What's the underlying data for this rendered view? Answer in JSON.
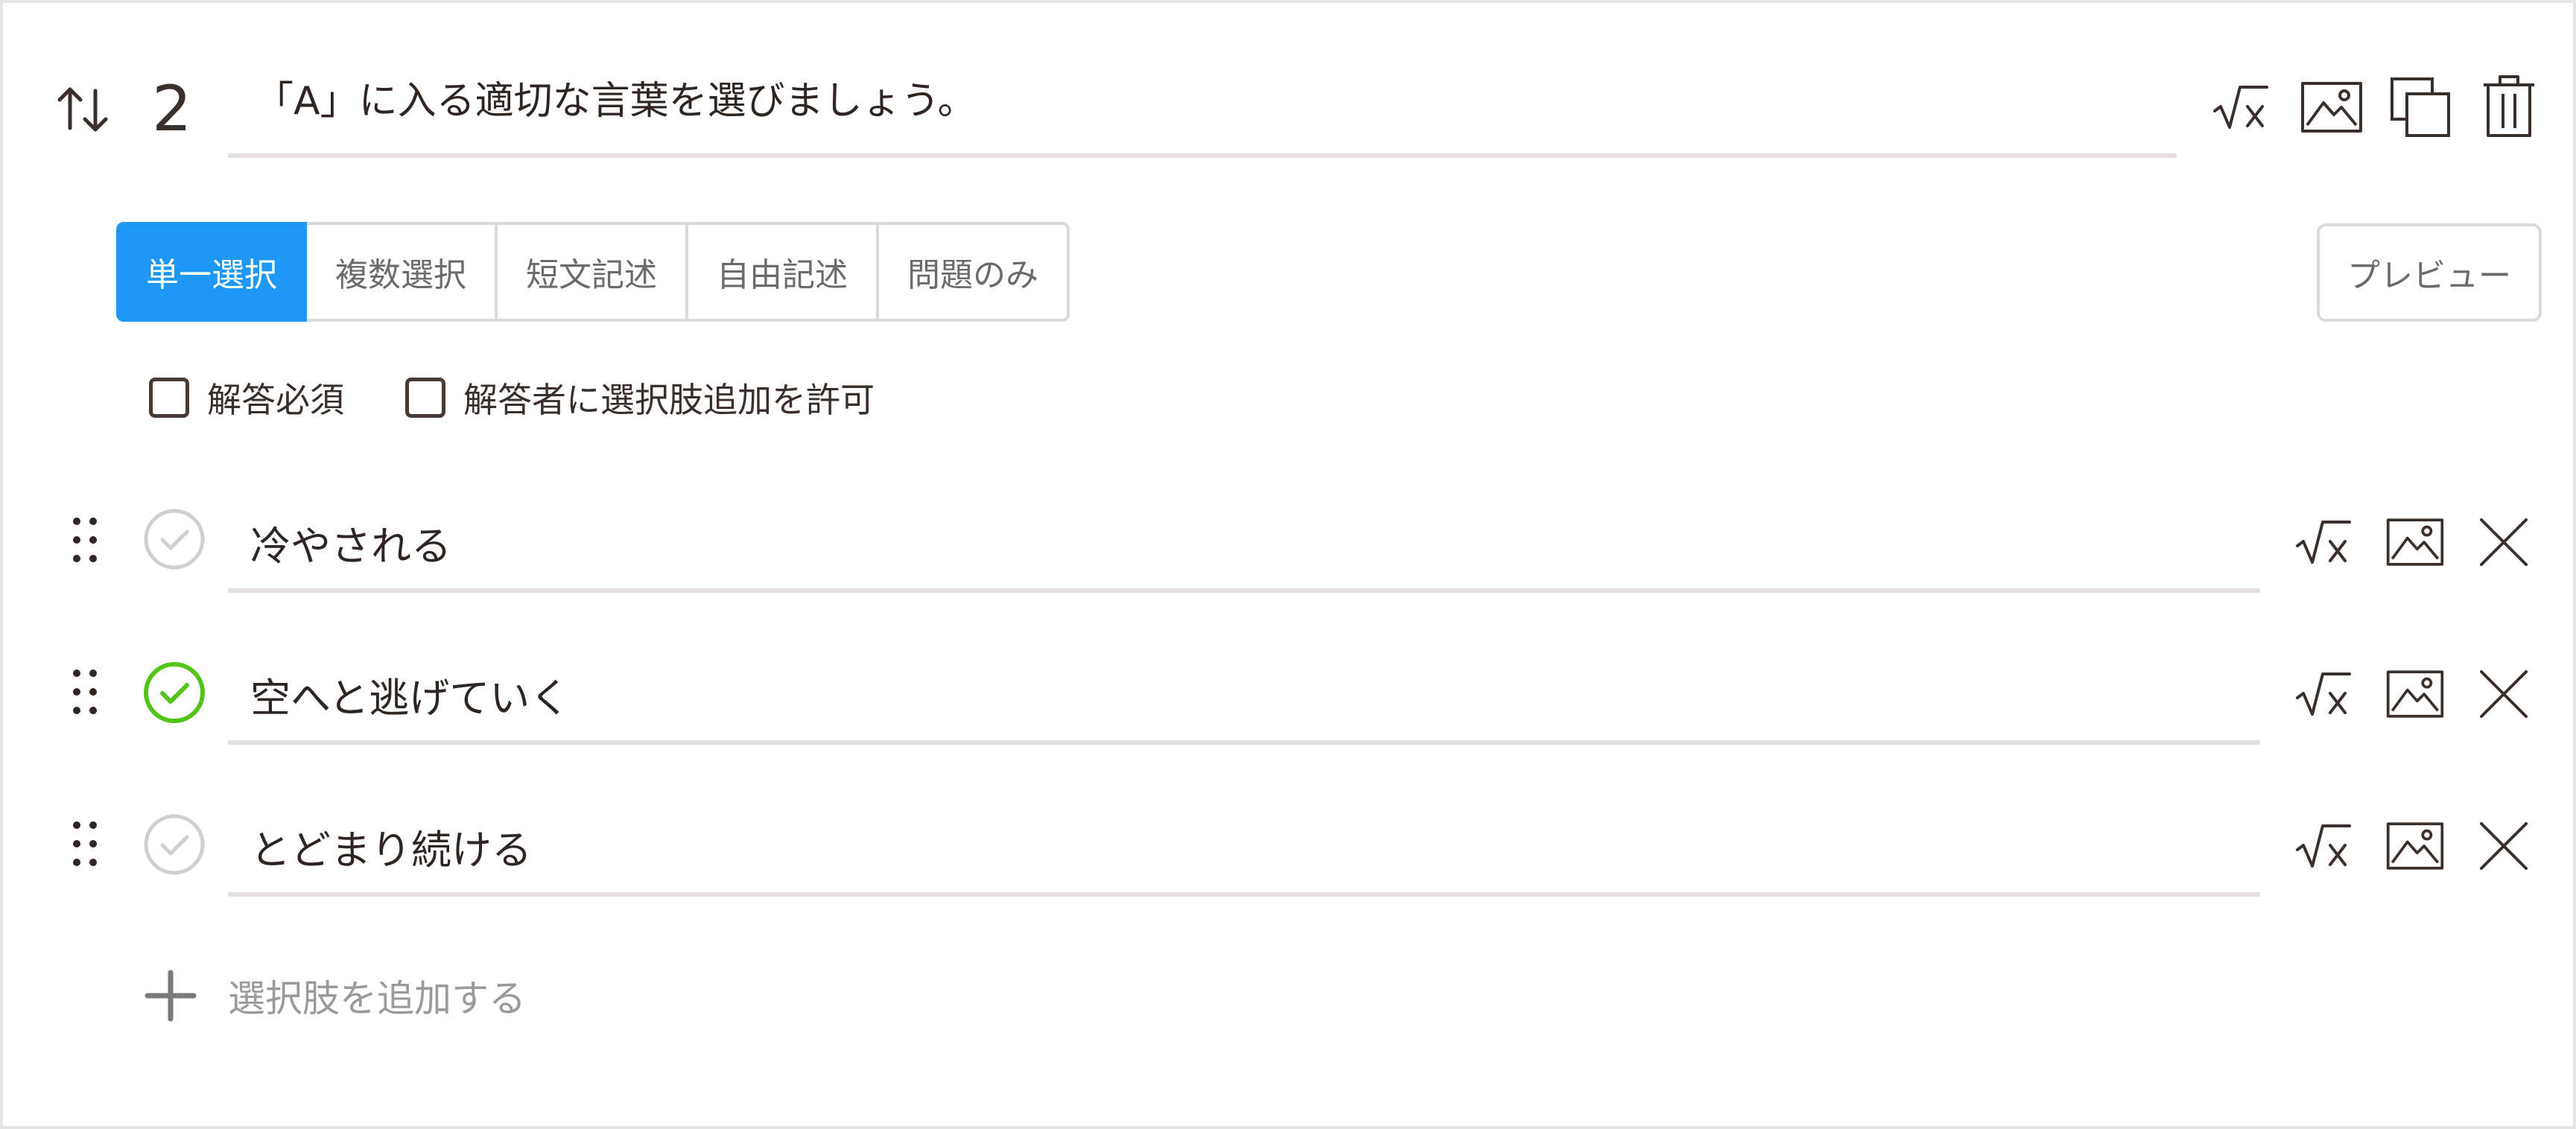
{
  "question": {
    "number": "2",
    "text": "「A」に入る適切な言葉を選びましょう。"
  },
  "header_icons": [
    "sqrt-x-icon",
    "image-icon",
    "copy-icon",
    "trash-icon"
  ],
  "types": {
    "tabs": [
      {
        "label": "単一選択",
        "active": true
      },
      {
        "label": "複数選択",
        "active": false
      },
      {
        "label": "短文記述",
        "active": false
      },
      {
        "label": "自由記述",
        "active": false
      },
      {
        "label": "問題のみ",
        "active": false
      }
    ],
    "preview_label": "プレビュー"
  },
  "options_settings": {
    "required_label": "解答必須",
    "allow_add_label": "解答者に選択肢追加を許可"
  },
  "choices": [
    {
      "text": "冷やされる",
      "correct": false
    },
    {
      "text": "空へと逃げていく",
      "correct": true
    },
    {
      "text": "とどまり続ける",
      "correct": false
    }
  ],
  "add_choice_label": "選択肢を追加する",
  "colors": {
    "accent": "#1e98f6",
    "correct": "#52c41a",
    "unchecked_mark": "#cfcfcf",
    "underline": "#e5dede"
  }
}
